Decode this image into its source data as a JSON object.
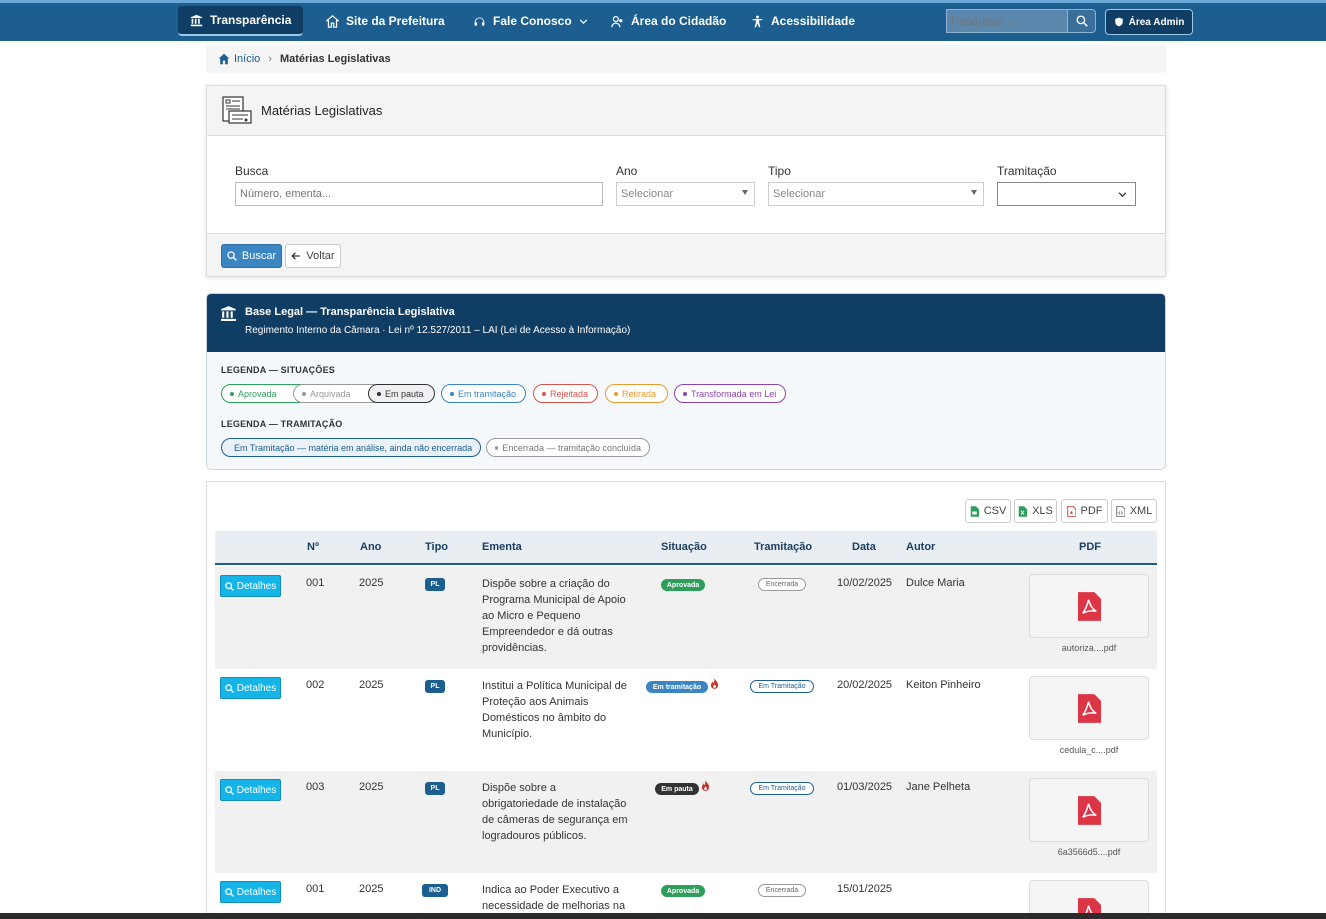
{
  "nav": {
    "items": [
      {
        "label": "Transparência",
        "icon": "bank-icon"
      },
      {
        "label": "Site da Prefeitura",
        "icon": "home-icon"
      },
      {
        "label": "Fale Conosco",
        "icon": "headset-icon"
      },
      {
        "label": "Área do Cidadão",
        "icon": "user-group-icon"
      },
      {
        "label": "Acessibilidade",
        "icon": "accessibility-icon"
      }
    ],
    "search_placeholder": "Pesquisar...",
    "admin_label": "Área Admin"
  },
  "breadcrumb": {
    "home": "Início",
    "current": "Matérias Legislativas"
  },
  "filter": {
    "title": "Matérias Legislativas",
    "busca_label": "Busca",
    "busca_placeholder": "Número, ementa...",
    "ano_label": "Ano",
    "ano_value": "Selecionar",
    "tipo_label": "Tipo",
    "tipo_value": "Selecionar",
    "tramitacao_label": "Tramitação",
    "tramitacao_value": "",
    "buscar_label": "Buscar",
    "voltar_label": "Voltar"
  },
  "legal": {
    "title": "Base Legal — Transparência Legislativa",
    "subtitle": "Regimento Interno da Câmara  ·  Lei nº 12.527/2011 – LAI (Lei de Acesso à Informação)",
    "situacoes_title": "LEGENDA — SITUAÇÕES",
    "situacoes": [
      {
        "label": "Aprovada",
        "color": "#2e9e5b"
      },
      {
        "label": "Arquivada",
        "color": "#999999"
      },
      {
        "label": "Em pauta",
        "color": "#333333"
      },
      {
        "label": "Em tramitação",
        "color": "#3a85c2"
      },
      {
        "label": "Rejeitada",
        "color": "#d9534f"
      },
      {
        "label": "Retirada",
        "color": "#e99a2c"
      },
      {
        "label": "Transformada em Lei",
        "color": "#8e44ad"
      }
    ],
    "tramitacao_title": "LEGENDA — TRAMITAÇÃO",
    "tramitacao": [
      {
        "label": "Em Tramitação — matéria em análise, ainda não encerrada",
        "color": "#1b5e8f"
      },
      {
        "label": "Encerrada — tramitação concluída",
        "color": "#999999"
      }
    ]
  },
  "export": {
    "csv": "CSV",
    "xls": "XLS",
    "pdf": "PDF",
    "xml": "XML"
  },
  "table": {
    "headers": [
      "Nº",
      "Ano",
      "Tipo",
      "Ementa",
      "Situação",
      "Tramitação",
      "Data",
      "Autor",
      "PDF"
    ],
    "details_label": "Detalhes",
    "rows": [
      {
        "numero": "001",
        "ano": "2025",
        "tipo": "PL",
        "ementa": "Dispõe sobre a criação do Programa Municipal de Apoio ao Micro e Pequeno Empreendedor e dá outras providências.",
        "situacao": "Aprovada",
        "situacao_color": "#2e9e5b",
        "urgente": false,
        "tramitacao": "Encerrada",
        "data": "10/02/2025",
        "autor": "Dulce Maria",
        "pdf": "autoriza....pdf"
      },
      {
        "numero": "002",
        "ano": "2025",
        "tipo": "PL",
        "ementa": "Institui a Política Municipal de Proteção aos Animais Domésticos no âmbito do Município.",
        "situacao": "Em tramitação",
        "situacao_color": "#3a85c2",
        "urgente": true,
        "tramitacao": "Em Tramitação",
        "data": "20/02/2025",
        "autor": "Keiton Pinheiro",
        "pdf": "cedula_c....pdf"
      },
      {
        "numero": "003",
        "ano": "2025",
        "tipo": "PL",
        "ementa": "Dispõe sobre a obrigatoriedade de instalação de câmeras de segurança em logradouros públicos.",
        "situacao": "Em pauta",
        "situacao_color": "#333333",
        "urgente": true,
        "tramitacao": "Em Tramitação",
        "data": "01/03/2025",
        "autor": "Jane Pelheta",
        "pdf": "6a3566d5....pdf"
      },
      {
        "numero": "001",
        "ano": "2025",
        "tipo": "IND",
        "ementa": "Indica ao Poder Executivo a necessidade de melhorias na",
        "situacao": "Aprovada",
        "situacao_color": "#2e9e5b",
        "urgente": false,
        "tramitacao": "Encerrada",
        "data": "15/01/2025",
        "autor": "",
        "pdf": ""
      }
    ]
  }
}
